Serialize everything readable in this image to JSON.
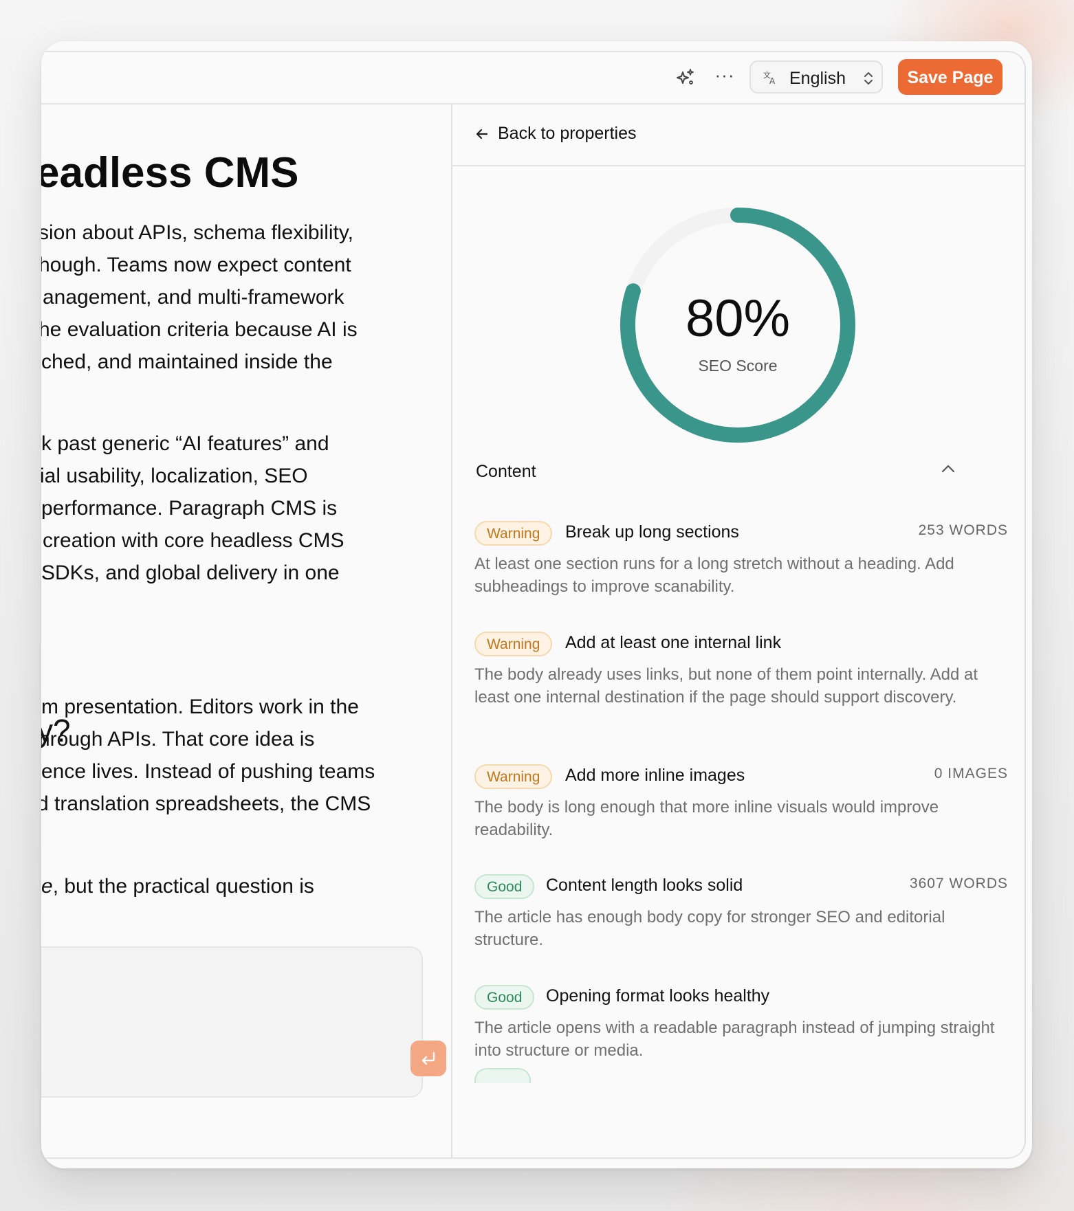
{
  "toolbar": {
    "language": "English",
    "save_label": "Save Page"
  },
  "editor": {
    "title": "eadless CMS",
    "paragraph1": [
      "sion about APIs, schema flexibility,",
      "hough. Teams now expect content",
      "anagement, and multi-framework",
      "he evaluation criteria because AI is",
      "ched, and maintained inside the"
    ],
    "paragraph2": [
      "k past generic “AI features” and",
      "ial usability, localization, SEO",
      "performance. Paragraph CMS is",
      "creation with core headless CMS",
      "SDKs, and global delivery in one"
    ],
    "heading2": "y?",
    "paragraph3": [
      "m presentation. Editors work in the",
      "hrough APIs. That core idea is",
      "ence lives. Instead of pushing teams",
      "d translation spreadsheets, the CMS"
    ],
    "paragraph4_em": "e",
    "paragraph4_rest": ", but the practical question is"
  },
  "panel": {
    "back_label": "Back to properties",
    "score": {
      "value": 0.8,
      "display": "80%",
      "caption": "SEO Score",
      "color": "#3a968a"
    },
    "section": "Content",
    "checks": [
      {
        "status": "Warning",
        "title": "Break up long sections",
        "meta": "253 WORDS",
        "desc": "At least one section runs for a long stretch without a heading. Add subheadings to improve scanability."
      },
      {
        "status": "Warning",
        "title": "Add at least one internal link",
        "meta": "",
        "desc": "The body already uses links, but none of them point internally. Add at least one internal destination if the page should support discovery."
      },
      {
        "status": "Warning",
        "title": "Add more inline images",
        "meta": "0 IMAGES",
        "desc": "The body is long enough that more inline visuals would improve readability."
      },
      {
        "status": "Good",
        "title": "Content length looks solid",
        "meta": "3607 WORDS",
        "desc": "The article has enough body copy for stronger SEO and editorial structure."
      },
      {
        "status": "Good",
        "title": "Opening format looks healthy",
        "meta": "",
        "desc": "The article opens with a readable paragraph instead of jumping straight into structure or media."
      }
    ]
  },
  "colors": {
    "accent": "#ec6a34",
    "gauge": "#3a968a",
    "warning": "#c1771b",
    "good": "#2b8a5a"
  }
}
